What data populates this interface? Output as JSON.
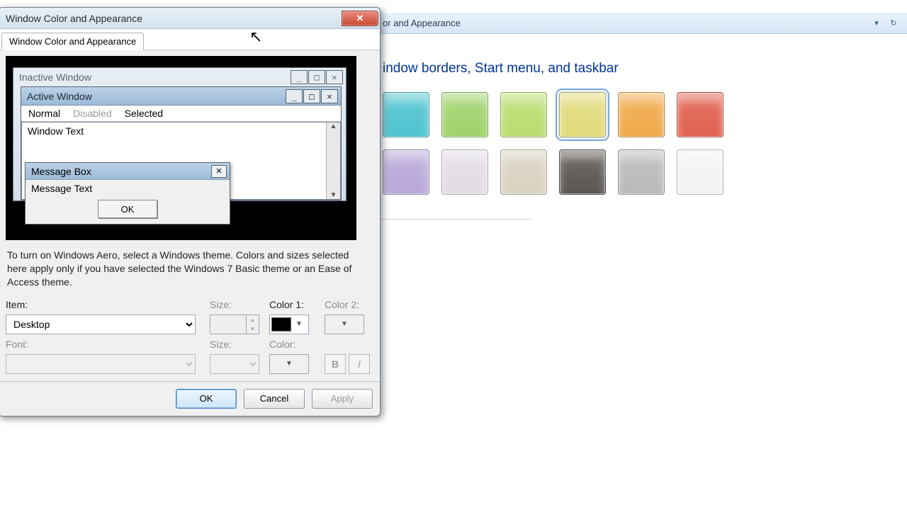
{
  "bg": {
    "title_suffix": "or and Appearance",
    "heading_suffix": "indow borders, Start menu, and taskbar",
    "swatches": [
      {
        "color": "#4fc3cf",
        "selected": false
      },
      {
        "color": "#9ed26a",
        "selected": false
      },
      {
        "color": "#b9dd6f",
        "selected": false
      },
      {
        "color": "#e0da7a",
        "selected": true
      },
      {
        "color": "#f0a94a",
        "selected": false
      },
      {
        "color": "#e0604f",
        "selected": false
      },
      {
        "color": "#b8a8d8",
        "selected": false
      },
      {
        "color": "#e2dce4",
        "selected": false
      },
      {
        "color": "#d8d2c0",
        "selected": false
      },
      {
        "color": "#5c5652",
        "selected": false
      },
      {
        "color": "#b9b9b9",
        "selected": false
      },
      {
        "color": "#f2f2f2",
        "selected": false
      }
    ]
  },
  "dialog": {
    "title": "Window Color and Appearance",
    "tab": "Window Color and Appearance",
    "preview": {
      "inactive_title": "Inactive Window",
      "active_title": "Active Window",
      "menu_normal": "Normal",
      "menu_disabled": "Disabled",
      "menu_selected": "Selected",
      "window_text": "Window Text",
      "msgbox_title": "Message Box",
      "msgbox_text": "Message Text",
      "msgbox_ok": "OK"
    },
    "note": "To turn on Windows Aero, select a Windows theme.  Colors and sizes selected here apply only if you have selected the Windows 7 Basic theme or an Ease of Access theme.",
    "labels": {
      "item": "Item:",
      "size": "Size:",
      "color1": "Color 1:",
      "color2": "Color 2:",
      "font": "Font:",
      "color": "Color:"
    },
    "item_value": "Desktop",
    "size_value": "",
    "color1_swatch": "#000000",
    "buttons": {
      "ok": "OK",
      "cancel": "Cancel",
      "apply": "Apply",
      "bold": "B",
      "italic": "I"
    }
  }
}
